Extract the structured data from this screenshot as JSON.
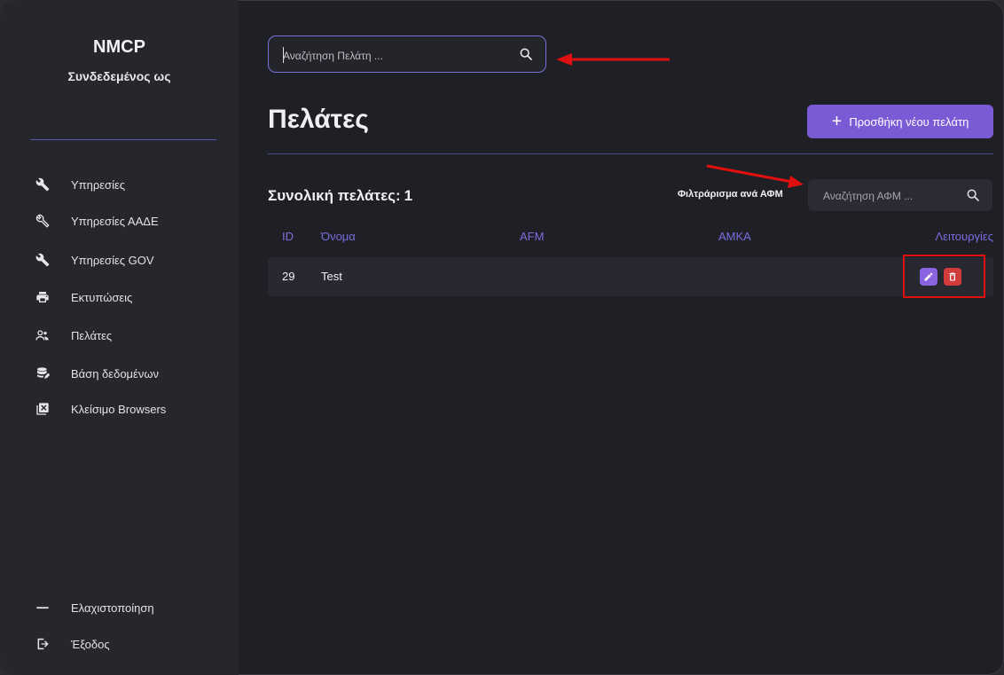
{
  "sidebar": {
    "brand": "NMCP",
    "logged_in_as": "Συνδεδεμένος ως",
    "items": [
      {
        "label": "Υπηρεσίες",
        "icon": "wrench-icon"
      },
      {
        "label": "Υπηρεσίες ΑΑΔΕ",
        "icon": "wrench-outline-icon"
      },
      {
        "label": "Υπηρεσίες GOV",
        "icon": "wrench-icon"
      },
      {
        "label": "Εκτυπώσεις",
        "icon": "printer-icon"
      },
      {
        "label": "Πελάτες",
        "icon": "people-icon"
      },
      {
        "label": "Βάση δεδομένων",
        "icon": "database-icon"
      },
      {
        "label": "Κλείσιμο Browsers",
        "icon": "close-box-icon"
      }
    ],
    "bottom": [
      {
        "label": "Ελαχιστοποίηση",
        "icon": "minimize-icon"
      },
      {
        "label": "Έξοδος",
        "icon": "logout-icon"
      }
    ]
  },
  "search": {
    "placeholder": "Αναζήτηση Πελάτη ..."
  },
  "page": {
    "title": "Πελάτες",
    "add_button": "Προσθήκη νέου πελάτη",
    "total_label": "Συνολική πελάτες:",
    "total_count": "1",
    "filter_label": "Φιλτράρισμα ανά ΑΦΜ",
    "afm_placeholder": "Αναζήτηση ΑΦΜ ..."
  },
  "table": {
    "headers": {
      "id": "ID",
      "name": "Όνομα",
      "afm": "AFM",
      "amka": "AMKA",
      "actions": "Λειτουργίες"
    },
    "rows": [
      {
        "id": "29",
        "name": "Test",
        "afm": "",
        "amka": ""
      }
    ]
  },
  "colors": {
    "accent": "#7b5ad6",
    "danger": "#d13b3b",
    "annotation": "#e01010",
    "background": "#1f2025",
    "sidebar": "#26272c"
  }
}
